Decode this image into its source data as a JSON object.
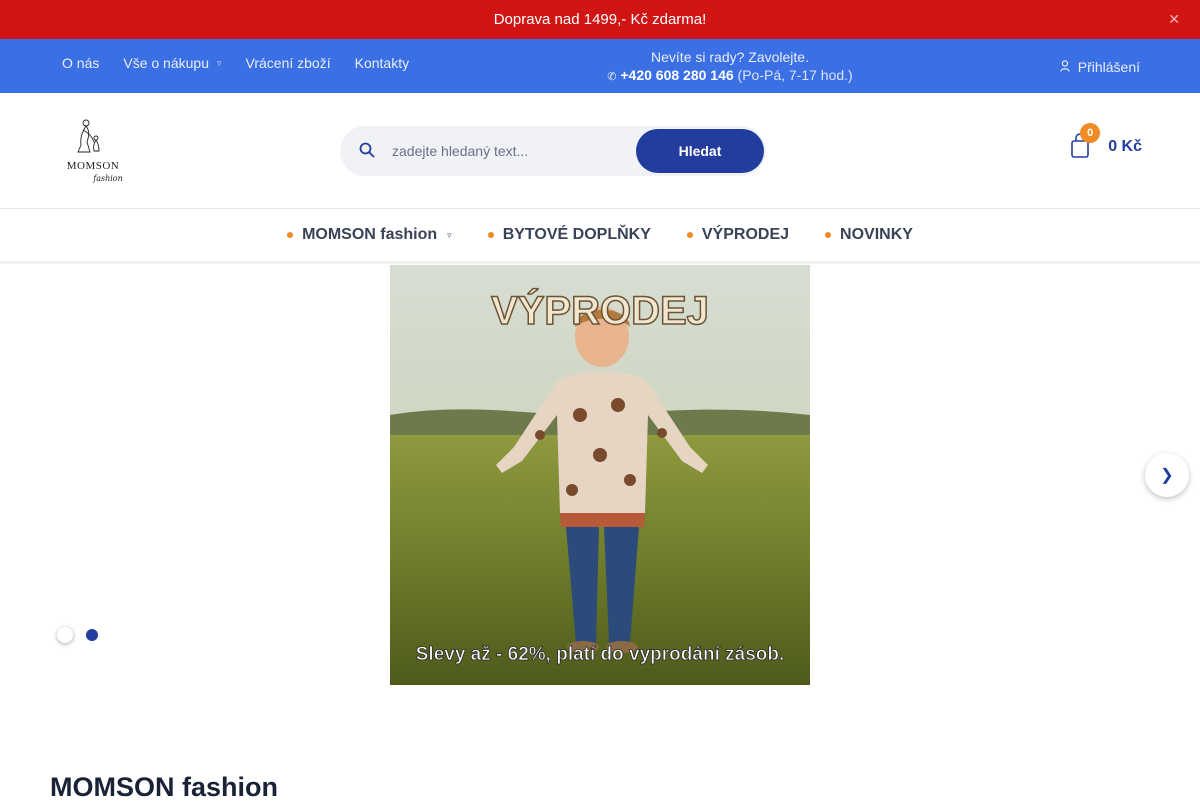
{
  "announce": {
    "text": "Doprava nad 1499,- Kč zdarma!",
    "close_icon": "close-icon"
  },
  "utility": {
    "links": [
      {
        "label": "O nás"
      },
      {
        "label": "Vše o nákupu",
        "has_dropdown": true
      },
      {
        "label": "Vrácení zboží"
      },
      {
        "label": "Kontakty"
      }
    ],
    "phone_prompt": "Nevíte si rady? Zavolejte.",
    "phone_number": "+420 608 280 146",
    "phone_hours": "(Po-Pá, 7-17 hod.)",
    "login_label": "Přihlášení"
  },
  "header": {
    "logo_text": "MOMSON",
    "logo_sub": "fashion",
    "search_placeholder": "zadejte hledaný text...",
    "search_button": "Hledat",
    "cart_count": "0",
    "cart_total": "0 Kč"
  },
  "catnav": {
    "items": [
      {
        "label": "MOMSON fashion",
        "has_dropdown": true
      },
      {
        "label": "BYTOVÉ DOPLŇKY"
      },
      {
        "label": "VÝPRODEJ"
      },
      {
        "label": "NOVINKY"
      }
    ]
  },
  "hero": {
    "headline": "VÝPRODEJ",
    "caption": "Slevy až - 62%, platí do vyprodání zásob.",
    "slide_count": 2,
    "active_slide": 2
  },
  "section": {
    "title": "MOMSON fashion"
  },
  "colors": {
    "announce": "#d11414",
    "utility": "#3b6fe4",
    "brand": "#233d9e",
    "accent": "#f08a24"
  }
}
